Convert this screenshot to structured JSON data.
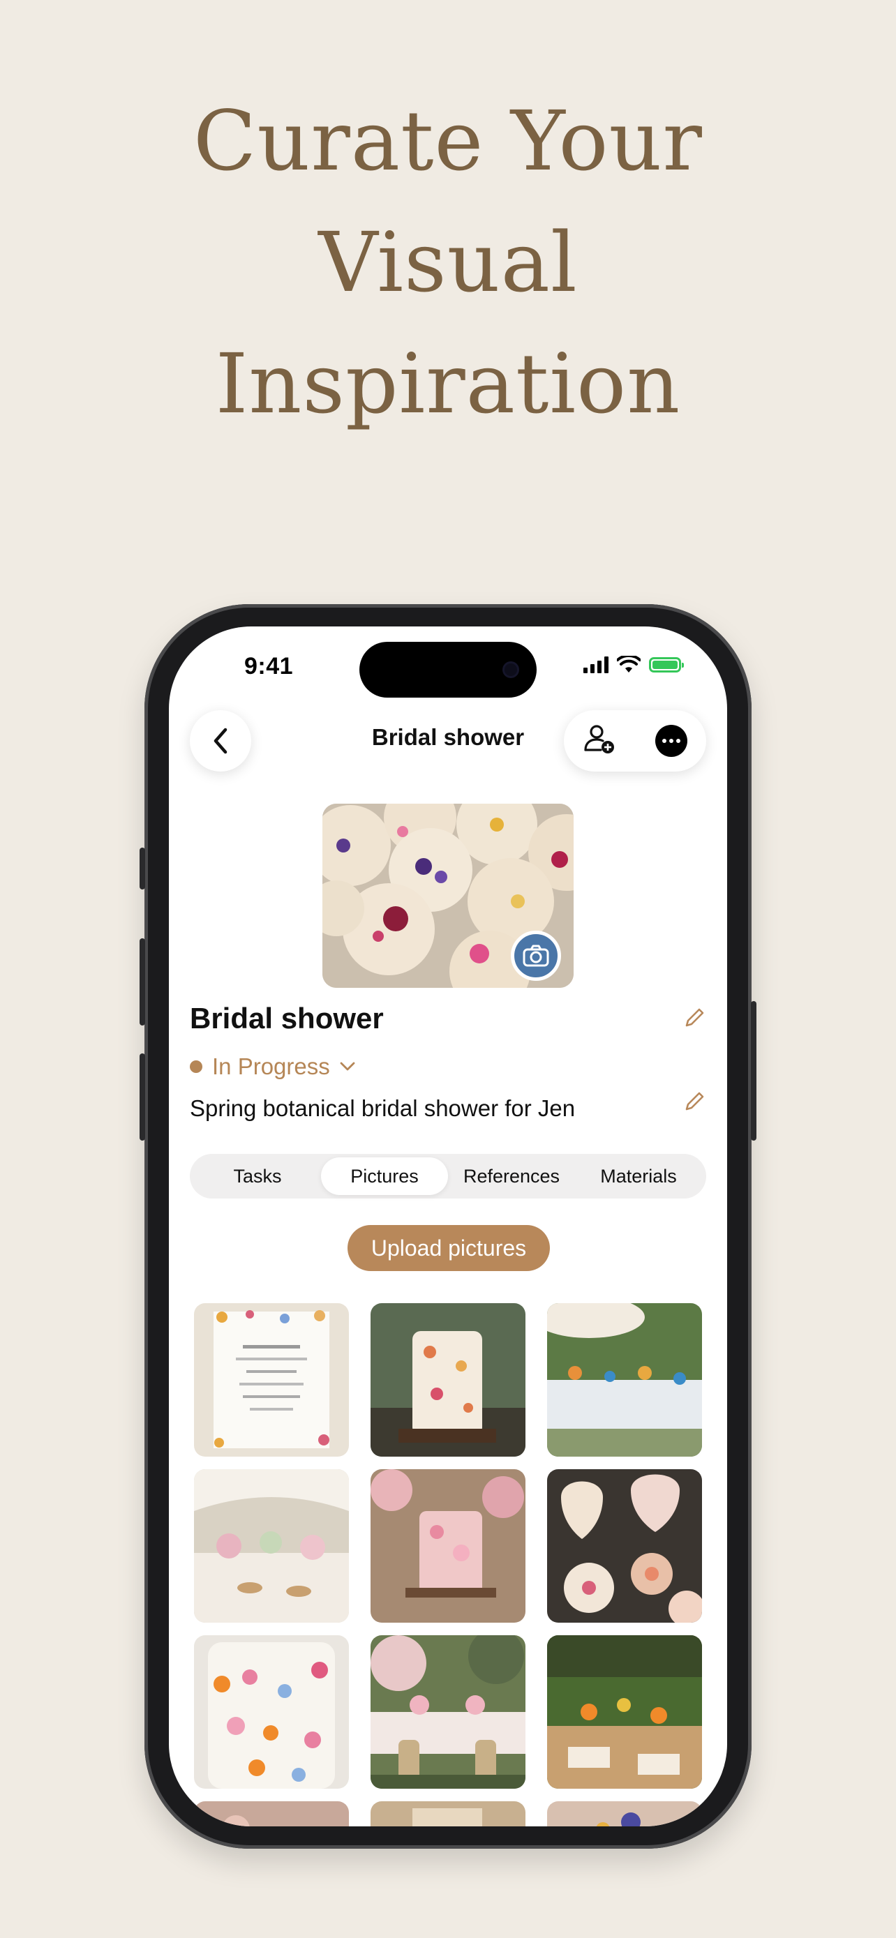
{
  "headline": [
    "Curate Your",
    "Visual",
    "Inspiration"
  ],
  "status_bar": {
    "time": "9:41"
  },
  "nav": {
    "title": "Bridal shower"
  },
  "project": {
    "title": "Bridal shower",
    "status": "In Progress",
    "description": "Spring botanical bridal shower for Jen"
  },
  "tabs": [
    "Tasks",
    "Pictures",
    "References",
    "Materials"
  ],
  "active_tab": "Pictures",
  "upload_label": "Upload pictures",
  "colors": {
    "accent": "#b8885a",
    "status": "#b58656",
    "headline": "#7b6243",
    "background": "#f0ebe3"
  },
  "grid_images": [
    "invitation card",
    "floral cake",
    "garden table",
    "reception table",
    "pink floral cake",
    "decorated cookies",
    "white floral cake",
    "garden dinner",
    "outdoor table"
  ]
}
